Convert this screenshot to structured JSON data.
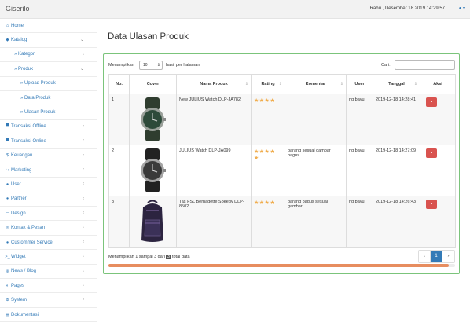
{
  "app": {
    "brand": "Giserilo",
    "datetime": "Rabu , Desember 18 2019 14:29:57"
  },
  "sidebar": {
    "items": [
      {
        "label": "Home",
        "icon": "home-icon",
        "glyph": "⌂"
      },
      {
        "label": "Katalog",
        "icon": "tags-icon",
        "glyph": "◆"
      },
      {
        "label": "» Kategori"
      },
      {
        "label": "» Produk"
      },
      {
        "label": "» Upload Produk"
      },
      {
        "label": "» Data Produk"
      },
      {
        "label": "» Ulasan Produk"
      },
      {
        "label": "Transaksi Offline",
        "icon": "cart-icon",
        "glyph": "▀"
      },
      {
        "label": "Transaksi Online",
        "icon": "cart-icon",
        "glyph": "▀"
      },
      {
        "label": "Keuangan",
        "icon": "dollar-icon",
        "glyph": "$"
      },
      {
        "label": "Marketing",
        "icon": "share-icon",
        "glyph": "↪"
      },
      {
        "label": "User",
        "icon": "user-icon",
        "glyph": "●"
      },
      {
        "label": "Partner",
        "icon": "users-icon",
        "glyph": "●"
      },
      {
        "label": "Design",
        "icon": "desktop-icon",
        "glyph": "▭"
      },
      {
        "label": "Kontak & Pesan",
        "icon": "envelope-icon",
        "glyph": "✉"
      },
      {
        "label": "Custommer Service",
        "icon": "comments-icon",
        "glyph": "●"
      },
      {
        "label": "Widget",
        "icon": "terminal-icon",
        "glyph": ">_"
      },
      {
        "label": "News / Blog",
        "icon": "globe-icon",
        "glyph": "◍"
      },
      {
        "label": "Pages",
        "icon": "toggle-icon",
        "glyph": "◐"
      },
      {
        "label": "System",
        "icon": "cogs-icon",
        "glyph": "⚙"
      },
      {
        "label": "Dokumentasi",
        "icon": "file-icon",
        "glyph": "▤"
      }
    ]
  },
  "main": {
    "title": "Data Ulasan Produk",
    "length": {
      "prefix": "Menampilkan",
      "value": "10",
      "suffix": "hasil per halaman"
    },
    "search": {
      "label": "Cari:"
    },
    "columns": [
      "No.",
      "Cover",
      "Nama Produk",
      "Rating",
      "Komentar",
      "User",
      "Tanggal",
      "Aksi"
    ],
    "rows": [
      {
        "no": "1",
        "product": "New JULIUS Watch DLP-JA782",
        "rating": "★★★★",
        "comment": "",
        "user": "ng bayu",
        "date": "2019-12-18 14:28:41",
        "image": "watch"
      },
      {
        "no": "2",
        "product": "JULIUS Watch DLP-JA099",
        "rating": "★★★★ ★",
        "comment": "barang sesuai gambar bagus",
        "user": "ng bayu",
        "date": "2019-12-18 14:27:09",
        "image": "watch"
      },
      {
        "no": "3",
        "product": "Tas FSL Bernadette Speedy DLP-8502",
        "rating": "★★★★",
        "comment": "barang bagus sesuai gambar",
        "user": "ng bayu",
        "date": "2019-12-18 14:26:43",
        "image": "backpack"
      }
    ],
    "info": {
      "prefix": "Menampilkan 1 sampai 3 dari",
      "count": "3",
      "suffix": "total data"
    },
    "pager": {
      "prev": "‹",
      "current": "1",
      "next": "›"
    },
    "scroll_fraction": 0.98
  },
  "colors": {
    "accent": "#337ab7",
    "star": "#f0ad4e",
    "danger": "#d9534f",
    "panel_border": "#7bc47b",
    "scroll_thumb": "#e78d5f"
  }
}
